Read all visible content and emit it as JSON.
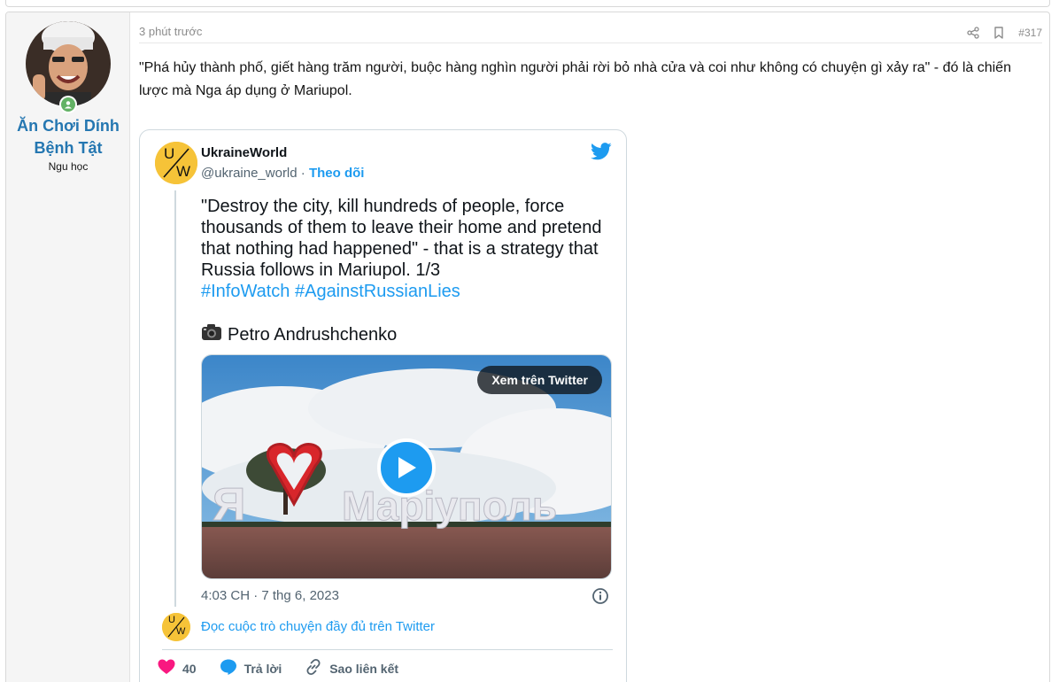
{
  "post": {
    "author": {
      "name": "Ăn Chơi Dính Bệnh Tật",
      "title": "Ngu học",
      "online": true
    },
    "time_ago": "3 phút trước",
    "post_number": "#317",
    "message": "\"Phá hủy thành phố, giết hàng trăm người, buộc hàng nghìn người phải rời bỏ nhà cửa và coi như không có chuyện gì xảy ra\" - đó là chiến lược mà Nga áp dụng ở Mariupol."
  },
  "tweet": {
    "account_name": "UkraineWorld",
    "handle": "@ukraine_world",
    "separator": " · ",
    "follow_label": "Theo dõi",
    "avatar_letters": {
      "top": "U",
      "bottom": "W"
    },
    "text": "\"Destroy the city, kill hundreds of people, force thousands of them to leave their home and pretend that nothing had happened\" - that is a strategy that Russia follows in Mariupol. 1/3",
    "hashtags": "#InfoWatch #AgainstRussianLies",
    "photo_credit_emoji": "📷",
    "photo_credit": "Petro Andrushchenko",
    "media": {
      "view_on_twitter_label": "Xem trên Twitter",
      "sign_text": "Я ❤ Маріуполь"
    },
    "date": "4:03 CH · 7 thg 6, 2023",
    "read_more": "Đọc cuộc trò chuyện đầy đủ trên Twitter",
    "likes": "40",
    "reply_label": "Trả lời",
    "copy_link_label": "Sao liên kết"
  },
  "colors": {
    "username": "#2577b1",
    "twitter_blue": "#1d9bf0",
    "like_red": "#f91880",
    "online_green": "#63b265",
    "avatar_yellow": "#f6c338"
  },
  "icons": [
    "share-icon",
    "bookmark-icon",
    "twitter-bird-icon",
    "camera-icon",
    "play-icon",
    "info-icon",
    "heart-icon",
    "reply-icon",
    "link-icon",
    "user-status-icon"
  ]
}
